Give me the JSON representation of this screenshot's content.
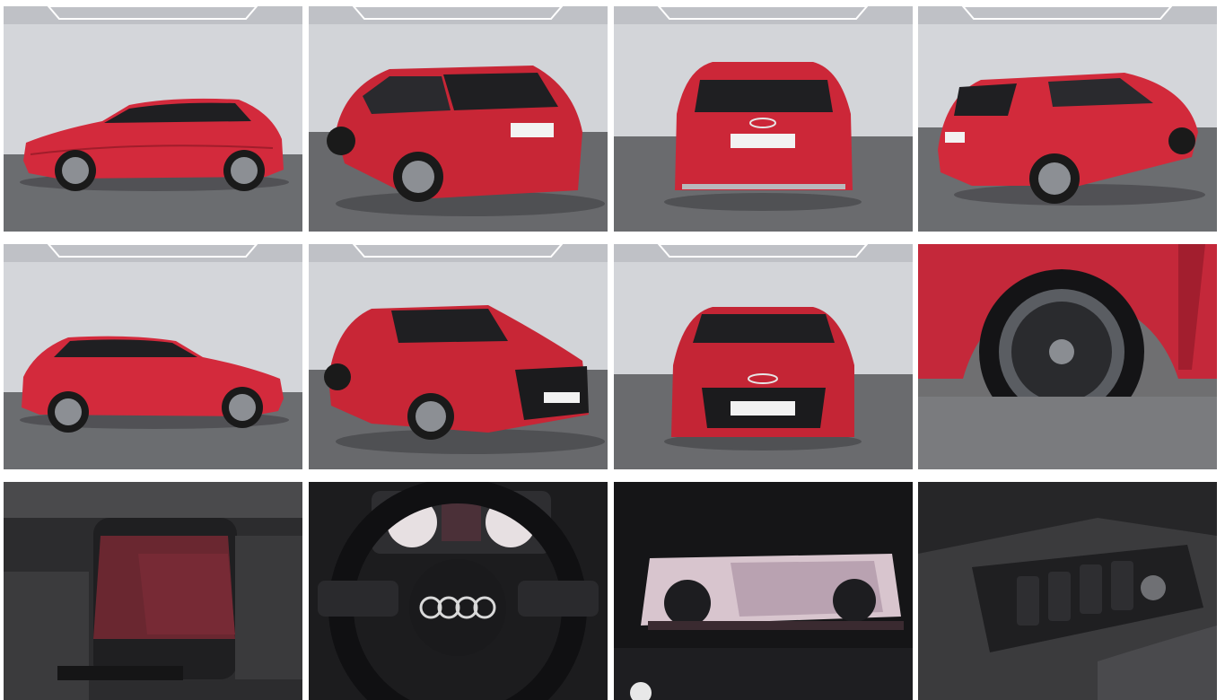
{
  "gallery": {
    "car_color": "#d32a3c",
    "photos": [
      {
        "name": "side-left"
      },
      {
        "name": "rear-three-quarter-left"
      },
      {
        "name": "rear"
      },
      {
        "name": "rear-three-quarter-right"
      },
      {
        "name": "side-right"
      },
      {
        "name": "front-three-quarter-left"
      },
      {
        "name": "front"
      },
      {
        "name": "wheel-closeup"
      },
      {
        "name": "seat-interior"
      },
      {
        "name": "steering-wheel"
      },
      {
        "name": "virtual-cockpit"
      },
      {
        "name": "door-controls"
      }
    ]
  }
}
